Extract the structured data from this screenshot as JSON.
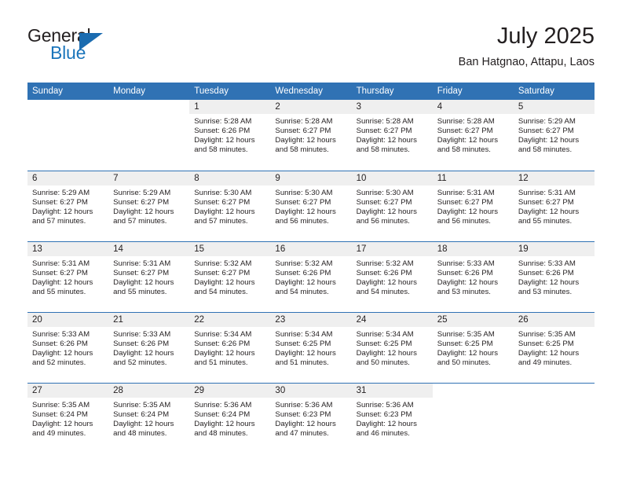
{
  "brand": {
    "name_line1": "General",
    "name_line2": "Blue",
    "logo_icon": "triangle-logo-icon",
    "accent_color": "#1b75bb"
  },
  "header": {
    "title": "July 2025",
    "subtitle": "Ban Hatgnao, Attapu, Laos"
  },
  "theme": {
    "header_blue": "#3072b4",
    "daynum_band": "#efefef",
    "text": "#231f20"
  },
  "calendar": {
    "weekday_headers": [
      "Sunday",
      "Monday",
      "Tuesday",
      "Wednesday",
      "Thursday",
      "Friday",
      "Saturday"
    ],
    "weeks": [
      [
        {
          "day": "",
          "lines": []
        },
        {
          "day": "",
          "lines": []
        },
        {
          "day": "1",
          "lines": [
            "Sunrise: 5:28 AM",
            "Sunset: 6:26 PM",
            "Daylight: 12 hours",
            "and 58 minutes."
          ]
        },
        {
          "day": "2",
          "lines": [
            "Sunrise: 5:28 AM",
            "Sunset: 6:27 PM",
            "Daylight: 12 hours",
            "and 58 minutes."
          ]
        },
        {
          "day": "3",
          "lines": [
            "Sunrise: 5:28 AM",
            "Sunset: 6:27 PM",
            "Daylight: 12 hours",
            "and 58 minutes."
          ]
        },
        {
          "day": "4",
          "lines": [
            "Sunrise: 5:28 AM",
            "Sunset: 6:27 PM",
            "Daylight: 12 hours",
            "and 58 minutes."
          ]
        },
        {
          "day": "5",
          "lines": [
            "Sunrise: 5:29 AM",
            "Sunset: 6:27 PM",
            "Daylight: 12 hours",
            "and 58 minutes."
          ]
        }
      ],
      [
        {
          "day": "6",
          "lines": [
            "Sunrise: 5:29 AM",
            "Sunset: 6:27 PM",
            "Daylight: 12 hours",
            "and 57 minutes."
          ]
        },
        {
          "day": "7",
          "lines": [
            "Sunrise: 5:29 AM",
            "Sunset: 6:27 PM",
            "Daylight: 12 hours",
            "and 57 minutes."
          ]
        },
        {
          "day": "8",
          "lines": [
            "Sunrise: 5:30 AM",
            "Sunset: 6:27 PM",
            "Daylight: 12 hours",
            "and 57 minutes."
          ]
        },
        {
          "day": "9",
          "lines": [
            "Sunrise: 5:30 AM",
            "Sunset: 6:27 PM",
            "Daylight: 12 hours",
            "and 56 minutes."
          ]
        },
        {
          "day": "10",
          "lines": [
            "Sunrise: 5:30 AM",
            "Sunset: 6:27 PM",
            "Daylight: 12 hours",
            "and 56 minutes."
          ]
        },
        {
          "day": "11",
          "lines": [
            "Sunrise: 5:31 AM",
            "Sunset: 6:27 PM",
            "Daylight: 12 hours",
            "and 56 minutes."
          ]
        },
        {
          "day": "12",
          "lines": [
            "Sunrise: 5:31 AM",
            "Sunset: 6:27 PM",
            "Daylight: 12 hours",
            "and 55 minutes."
          ]
        }
      ],
      [
        {
          "day": "13",
          "lines": [
            "Sunrise: 5:31 AM",
            "Sunset: 6:27 PM",
            "Daylight: 12 hours",
            "and 55 minutes."
          ]
        },
        {
          "day": "14",
          "lines": [
            "Sunrise: 5:31 AM",
            "Sunset: 6:27 PM",
            "Daylight: 12 hours",
            "and 55 minutes."
          ]
        },
        {
          "day": "15",
          "lines": [
            "Sunrise: 5:32 AM",
            "Sunset: 6:27 PM",
            "Daylight: 12 hours",
            "and 54 minutes."
          ]
        },
        {
          "day": "16",
          "lines": [
            "Sunrise: 5:32 AM",
            "Sunset: 6:26 PM",
            "Daylight: 12 hours",
            "and 54 minutes."
          ]
        },
        {
          "day": "17",
          "lines": [
            "Sunrise: 5:32 AM",
            "Sunset: 6:26 PM",
            "Daylight: 12 hours",
            "and 54 minutes."
          ]
        },
        {
          "day": "18",
          "lines": [
            "Sunrise: 5:33 AM",
            "Sunset: 6:26 PM",
            "Daylight: 12 hours",
            "and 53 minutes."
          ]
        },
        {
          "day": "19",
          "lines": [
            "Sunrise: 5:33 AM",
            "Sunset: 6:26 PM",
            "Daylight: 12 hours",
            "and 53 minutes."
          ]
        }
      ],
      [
        {
          "day": "20",
          "lines": [
            "Sunrise: 5:33 AM",
            "Sunset: 6:26 PM",
            "Daylight: 12 hours",
            "and 52 minutes."
          ]
        },
        {
          "day": "21",
          "lines": [
            "Sunrise: 5:33 AM",
            "Sunset: 6:26 PM",
            "Daylight: 12 hours",
            "and 52 minutes."
          ]
        },
        {
          "day": "22",
          "lines": [
            "Sunrise: 5:34 AM",
            "Sunset: 6:26 PM",
            "Daylight: 12 hours",
            "and 51 minutes."
          ]
        },
        {
          "day": "23",
          "lines": [
            "Sunrise: 5:34 AM",
            "Sunset: 6:25 PM",
            "Daylight: 12 hours",
            "and 51 minutes."
          ]
        },
        {
          "day": "24",
          "lines": [
            "Sunrise: 5:34 AM",
            "Sunset: 6:25 PM",
            "Daylight: 12 hours",
            "and 50 minutes."
          ]
        },
        {
          "day": "25",
          "lines": [
            "Sunrise: 5:35 AM",
            "Sunset: 6:25 PM",
            "Daylight: 12 hours",
            "and 50 minutes."
          ]
        },
        {
          "day": "26",
          "lines": [
            "Sunrise: 5:35 AM",
            "Sunset: 6:25 PM",
            "Daylight: 12 hours",
            "and 49 minutes."
          ]
        }
      ],
      [
        {
          "day": "27",
          "lines": [
            "Sunrise: 5:35 AM",
            "Sunset: 6:24 PM",
            "Daylight: 12 hours",
            "and 49 minutes."
          ]
        },
        {
          "day": "28",
          "lines": [
            "Sunrise: 5:35 AM",
            "Sunset: 6:24 PM",
            "Daylight: 12 hours",
            "and 48 minutes."
          ]
        },
        {
          "day": "29",
          "lines": [
            "Sunrise: 5:36 AM",
            "Sunset: 6:24 PM",
            "Daylight: 12 hours",
            "and 48 minutes."
          ]
        },
        {
          "day": "30",
          "lines": [
            "Sunrise: 5:36 AM",
            "Sunset: 6:23 PM",
            "Daylight: 12 hours",
            "and 47 minutes."
          ]
        },
        {
          "day": "31",
          "lines": [
            "Sunrise: 5:36 AM",
            "Sunset: 6:23 PM",
            "Daylight: 12 hours",
            "and 46 minutes."
          ]
        },
        {
          "day": "",
          "lines": []
        },
        {
          "day": "",
          "lines": []
        }
      ]
    ]
  }
}
